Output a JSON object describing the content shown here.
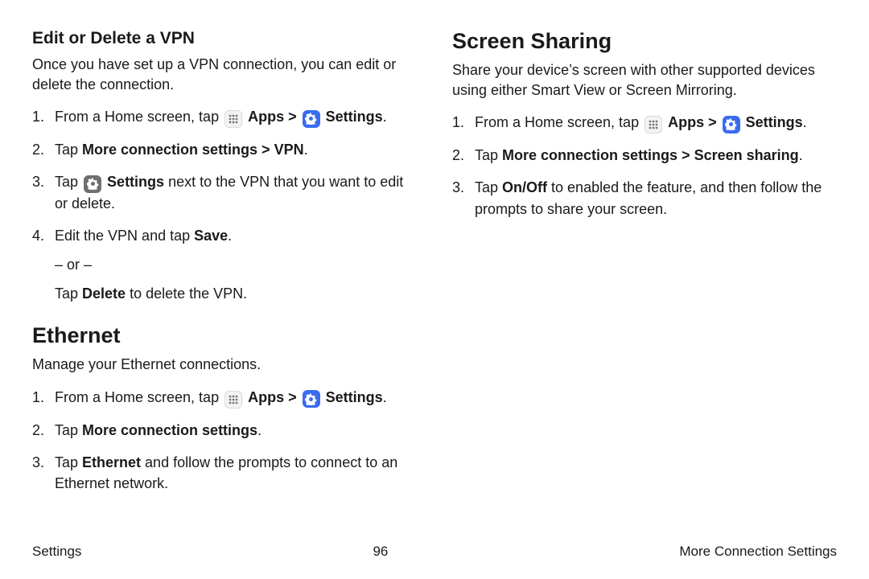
{
  "left": {
    "vpn": {
      "heading": "Edit or Delete a VPN",
      "intro": "Once you have set up a VPN connection, you can edit or delete the connection.",
      "step1_pre": "From a Home screen, tap ",
      "apps_label": "Apps",
      "sep": " > ",
      "settings_label": "Settings",
      "period": ".",
      "step2_pre": "Tap ",
      "step2_bold": "More connection settings > VPN",
      "step3_pre": "Tap ",
      "step3_mid": "Settings",
      "step3_post": " next to the VPN that you want to edit or delete.",
      "step4_pre": "Edit the VPN and tap ",
      "step4_bold": "Save",
      "or_line": "– or –",
      "step4b_pre": "Tap ",
      "step4b_bold": "Delete",
      "step4b_post": " to delete the VPN."
    },
    "ethernet": {
      "heading": "Ethernet",
      "intro": "Manage your Ethernet connections.",
      "step1_pre": "From a Home screen, tap ",
      "apps_label": "Apps",
      "sep": " > ",
      "settings_label": "Settings",
      "period": ".",
      "step2_pre": "Tap ",
      "step2_bold": "More connection settings",
      "step3_pre": "Tap ",
      "step3_bold": "Ethernet",
      "step3_post": " and follow the prompts to connect to an Ethernet network."
    }
  },
  "right": {
    "screen": {
      "heading": "Screen Sharing",
      "intro": "Share your device’s screen with other supported devices using either Smart View or Screen Mirroring.",
      "step1_pre": "From a Home screen, tap ",
      "apps_label": "Apps",
      "sep": " > ",
      "settings_label": "Settings",
      "period": ".",
      "step2_pre": "Tap ",
      "step2_bold": "More connection settings > Screen sharing",
      "step3_pre": "Tap ",
      "step3_bold": "On/Off",
      "step3_post": " to enabled the feature, and then follow the prompts to share your screen."
    }
  },
  "footer": {
    "left": "Settings",
    "center": "96",
    "right": "More Connection Settings"
  }
}
